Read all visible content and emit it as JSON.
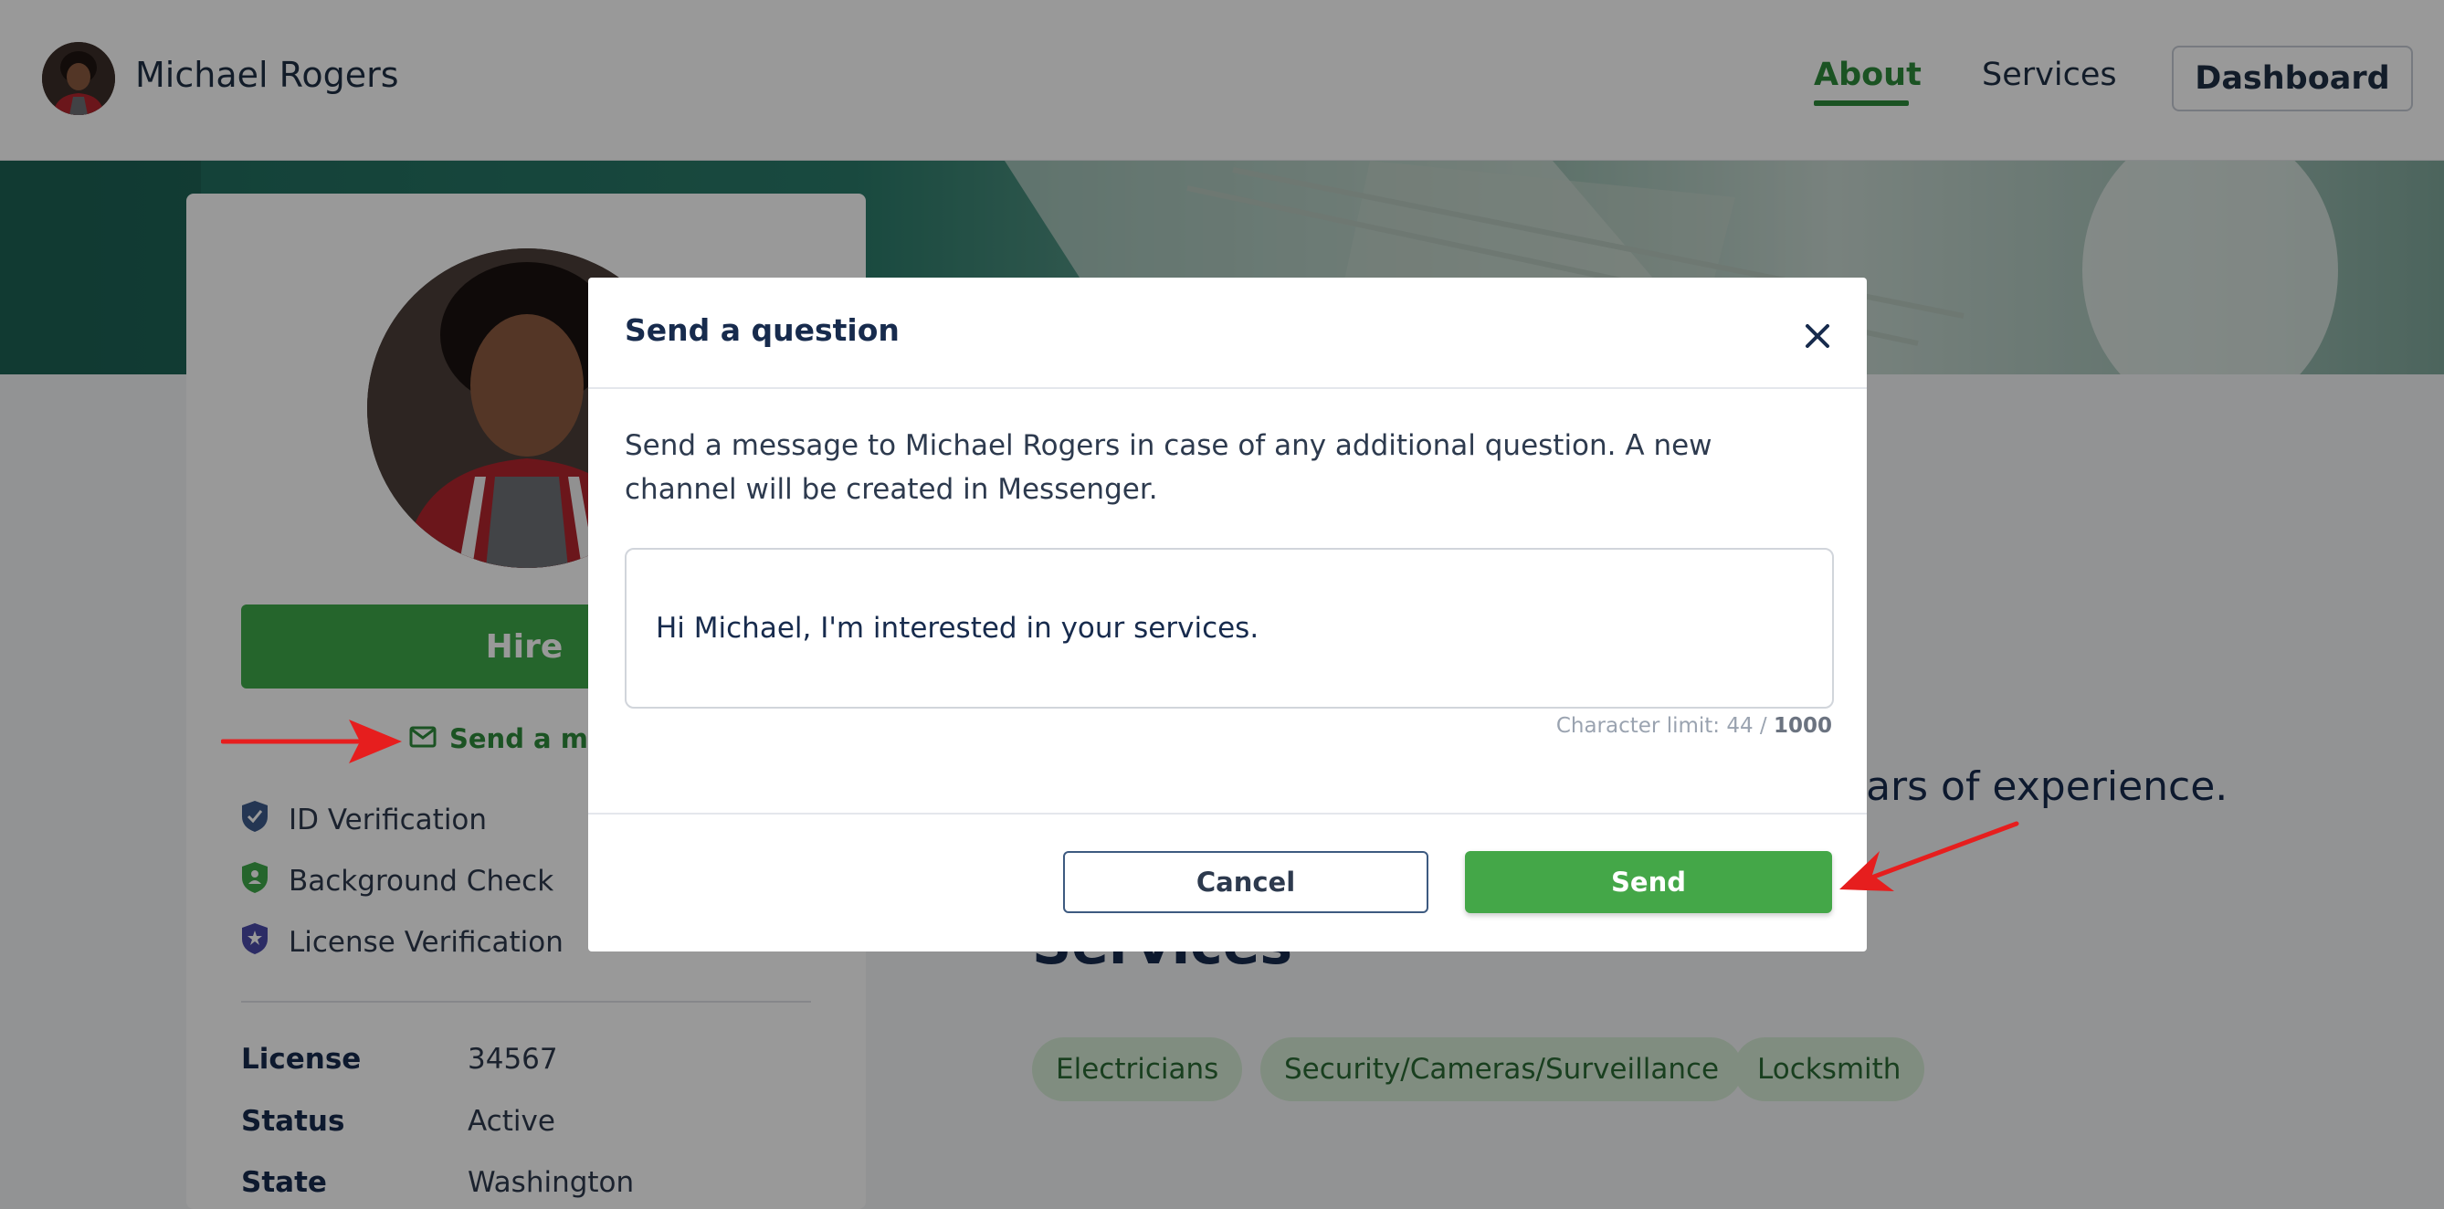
{
  "header": {
    "brand_name": "Michael Rogers",
    "nav": {
      "about": "About",
      "services": "Services",
      "dashboard": "Dashboard"
    }
  },
  "profile": {
    "hire_label": "Hire",
    "send_message_label": "Send a mes",
    "verifications": [
      {
        "label": "ID Verification",
        "icon": "shield-check-icon",
        "color": "#3d5a8a"
      },
      {
        "label": "Background Check",
        "icon": "shield-person-icon",
        "color": "#3fa84a"
      },
      {
        "label": "License Verification",
        "icon": "shield-star-icon",
        "color": "#4a4aa8"
      }
    ],
    "details": [
      {
        "label": "License",
        "value": "34567"
      },
      {
        "label": "Status",
        "value": "Active"
      },
      {
        "label": "State",
        "value": "Washington"
      }
    ]
  },
  "main": {
    "experience_text": "ears of experience.",
    "services_title": "Services",
    "service_chips": [
      "Electricians",
      "Security/Cameras/Surveillance",
      "Locksmith"
    ]
  },
  "modal": {
    "title": "Send a question",
    "description": "Send a message to Michael Rogers in case of any additional question. A new channel will be created in Messenger.",
    "message_value": "Hi Michael, I'm interested in your services.",
    "char_limit_prefix": "Character limit: 44 / ",
    "char_limit_max": "1000",
    "cancel_label": "Cancel",
    "send_label": "Send"
  },
  "colors": {
    "accent_green": "#3fa84a",
    "annotation_red": "#e61e1e"
  }
}
